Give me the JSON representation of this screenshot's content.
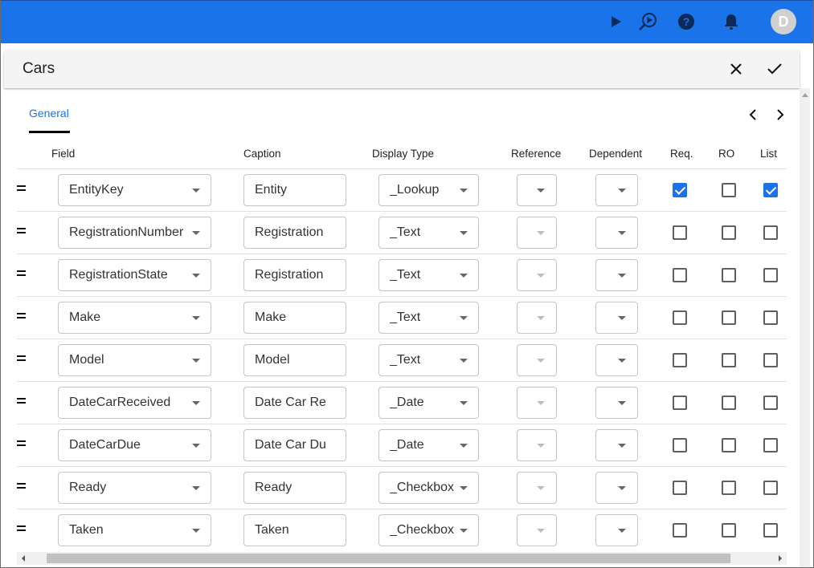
{
  "topbar": {
    "icons": [
      "play-icon",
      "search-play-icon",
      "help-icon",
      "bell-icon"
    ],
    "avatar_initial": "D",
    "brand_color": "#1a73e8"
  },
  "dialog": {
    "title": "Cars",
    "close_label": "close",
    "confirm_label": "confirm"
  },
  "tabs": [
    {
      "label": "General",
      "active": true
    }
  ],
  "columns": {
    "field": "Field",
    "caption": "Caption",
    "display_type": "Display Type",
    "reference": "Reference",
    "dependent": "Dependent",
    "req": "Req.",
    "ro": "RO",
    "list": "List"
  },
  "rows": [
    {
      "field": "EntityKey",
      "caption": "Entity",
      "display_type": "_Lookup",
      "reference": "",
      "reference_enabled": true,
      "dependent": "",
      "req": true,
      "ro": false,
      "list": true
    },
    {
      "field": "RegistrationNumber",
      "caption": "Registration",
      "display_type": "_Text",
      "reference": "",
      "reference_enabled": false,
      "dependent": "",
      "req": false,
      "ro": false,
      "list": false
    },
    {
      "field": "RegistrationState",
      "caption": "Registration",
      "display_type": "_Text",
      "reference": "",
      "reference_enabled": false,
      "dependent": "",
      "req": false,
      "ro": false,
      "list": false
    },
    {
      "field": "Make",
      "caption": "Make",
      "display_type": "_Text",
      "reference": "",
      "reference_enabled": false,
      "dependent": "",
      "req": false,
      "ro": false,
      "list": false
    },
    {
      "field": "Model",
      "caption": "Model",
      "display_type": "_Text",
      "reference": "",
      "reference_enabled": false,
      "dependent": "",
      "req": false,
      "ro": false,
      "list": false
    },
    {
      "field": "DateCarReceived",
      "caption": "Date Car Re",
      "display_type": "_Date",
      "reference": "",
      "reference_enabled": false,
      "dependent": "",
      "req": false,
      "ro": false,
      "list": false
    },
    {
      "field": "DateCarDue",
      "caption": "Date Car Du",
      "display_type": "_Date",
      "reference": "",
      "reference_enabled": false,
      "dependent": "",
      "req": false,
      "ro": false,
      "list": false
    },
    {
      "field": "Ready",
      "caption": "Ready",
      "display_type": "_Checkbox",
      "reference": "",
      "reference_enabled": false,
      "dependent": "",
      "req": false,
      "ro": false,
      "list": false
    },
    {
      "field": "Taken",
      "caption": "Taken",
      "display_type": "_Checkbox",
      "reference": "",
      "reference_enabled": false,
      "dependent": "",
      "req": false,
      "ro": false,
      "list": false
    }
  ]
}
